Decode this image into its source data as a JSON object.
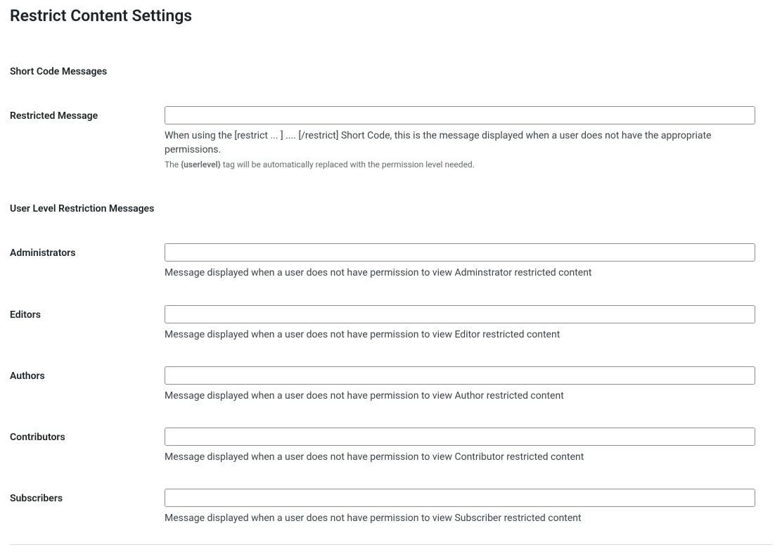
{
  "page": {
    "title": "Restrict Content Settings"
  },
  "sections": {
    "shortcode_heading": "Short Code Messages",
    "userlevel_heading": "User Level Restriction Messages"
  },
  "restricted": {
    "label": "Restricted Message",
    "value": "",
    "desc1": "When using the [restrict ... ] .... [/restrict] Short Code, this is the message displayed when a user does not have the appropriate permissions.",
    "desc2_prefix": "The ",
    "desc2_tag": "{userlevel}",
    "desc2_suffix": " tag will be automatically replaced with the permission level needed."
  },
  "levels": {
    "administrators": {
      "label": "Administrators",
      "value": "",
      "desc": "Message displayed when a user does not have permission to view Adminstrator restricted content"
    },
    "editors": {
      "label": "Editors",
      "value": "",
      "desc": "Message displayed when a user does not have permission to view Editor restricted content"
    },
    "authors": {
      "label": "Authors",
      "value": "",
      "desc": "Message displayed when a user does not have permission to view Author restricted content"
    },
    "contributors": {
      "label": "Contributors",
      "value": "",
      "desc": "Message displayed when a user does not have permission to view Contributor restricted content"
    },
    "subscribers": {
      "label": "Subscribers",
      "value": "",
      "desc": "Message displayed when a user does not have permission to view Subscriber restricted content"
    }
  }
}
